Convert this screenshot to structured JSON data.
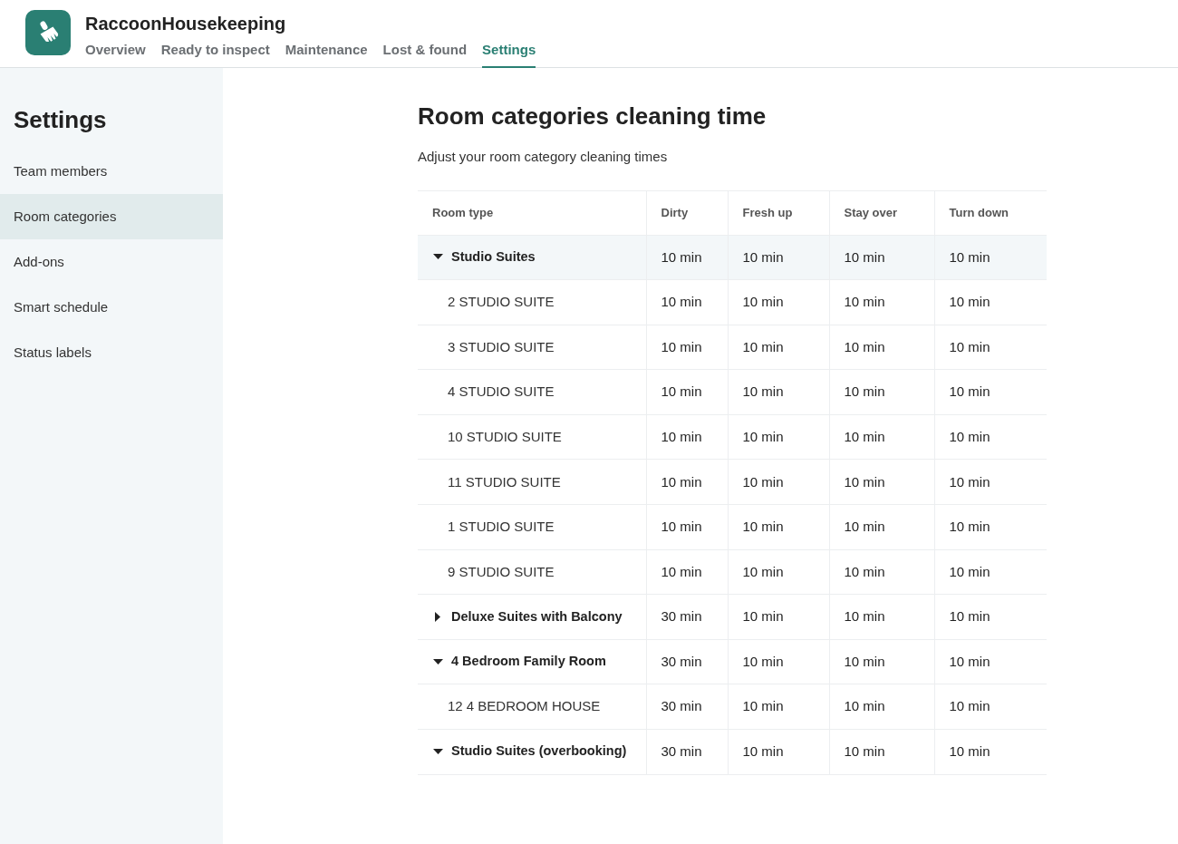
{
  "app": {
    "name": "RaccoonHousekeeping"
  },
  "nav": [
    {
      "label": "Overview",
      "selected": false
    },
    {
      "label": "Ready to inspect",
      "selected": false
    },
    {
      "label": "Maintenance",
      "selected": false
    },
    {
      "label": "Lost & found",
      "selected": false
    },
    {
      "label": "Settings",
      "selected": true
    }
  ],
  "sidebar": {
    "title": "Settings",
    "items": [
      {
        "label": "Team members",
        "selected": false
      },
      {
        "label": "Room categories",
        "selected": true
      },
      {
        "label": "Add-ons",
        "selected": false
      },
      {
        "label": "Smart schedule",
        "selected": false
      },
      {
        "label": "Status labels",
        "selected": false
      }
    ]
  },
  "page": {
    "title": "Room categories cleaning time",
    "subtitle": "Adjust your room category cleaning times"
  },
  "table": {
    "columns": [
      "Room type",
      "Dirty",
      "Fresh up",
      "Stay over",
      "Turn down"
    ],
    "rows": [
      {
        "name": "Studio Suites",
        "expanded": true,
        "hovered": true,
        "times": [
          "10 min",
          "10 min",
          "10 min",
          "10 min"
        ],
        "children": [
          {
            "name": "2 STUDIO SUITE",
            "times": [
              "10 min",
              "10 min",
              "10 min",
              "10 min"
            ]
          },
          {
            "name": "3 STUDIO SUITE",
            "times": [
              "10 min",
              "10 min",
              "10 min",
              "10 min"
            ]
          },
          {
            "name": "4 STUDIO SUITE",
            "times": [
              "10 min",
              "10 min",
              "10 min",
              "10 min"
            ]
          },
          {
            "name": "10 STUDIO SUITE",
            "times": [
              "10 min",
              "10 min",
              "10 min",
              "10 min"
            ]
          },
          {
            "name": "11 STUDIO SUITE",
            "times": [
              "10 min",
              "10 min",
              "10 min",
              "10 min"
            ]
          },
          {
            "name": "1 STUDIO SUITE",
            "times": [
              "10 min",
              "10 min",
              "10 min",
              "10 min"
            ]
          },
          {
            "name": "9 STUDIO SUITE",
            "times": [
              "10 min",
              "10 min",
              "10 min",
              "10 min"
            ]
          }
        ]
      },
      {
        "name": "Deluxe Suites with Balcony",
        "expanded": false,
        "hovered": false,
        "times": [
          "30 min",
          "10 min",
          "10 min",
          "10 min"
        ]
      },
      {
        "name": "4 Bedroom Family Room",
        "expanded": true,
        "hovered": false,
        "times": [
          "30 min",
          "10 min",
          "10 min",
          "10 min"
        ],
        "children": [
          {
            "name": "12 4 BEDROOM HOUSE",
            "times": [
              "30 min",
              "10 min",
              "10 min",
              "10 min"
            ]
          }
        ]
      },
      {
        "name": "Studio Suites (overbooking)",
        "expanded": true,
        "hovered": false,
        "times": [
          "30 min",
          "10 min",
          "10 min",
          "10 min"
        ]
      }
    ]
  }
}
